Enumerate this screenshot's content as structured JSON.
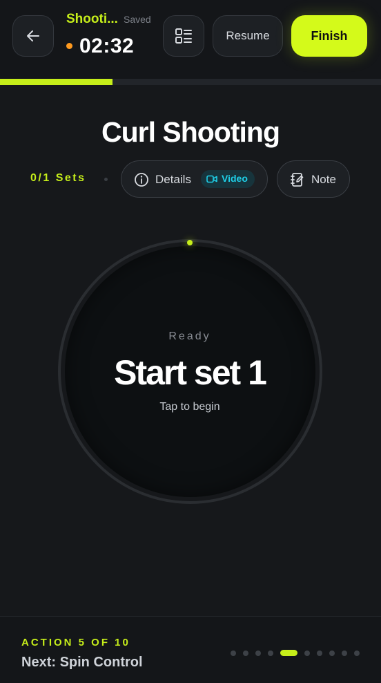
{
  "header": {
    "session_name": "Shooti...",
    "saved_label": "Saved",
    "timer": "02:32",
    "resume_label": "Resume",
    "finish_label": "Finish",
    "back_icon": "arrow-left-icon",
    "list_icon": "list-view-icon"
  },
  "progress": {
    "fraction": 0.295
  },
  "exercise": {
    "title": "Curl Shooting",
    "sets": "0/1 Sets",
    "details_label": "Details",
    "video_label": "Video",
    "note_label": "Note"
  },
  "dial": {
    "state": "Ready",
    "action": "Start set 1",
    "hint": "Tap to begin"
  },
  "footer": {
    "step": "ACTION 5 OF 10",
    "next": "Next: Spin Control",
    "total_steps": 10,
    "current_step": 5
  },
  "colors": {
    "accent": "#c6ee1a",
    "finish": "#d4fa1a",
    "recording": "#ff9a1f",
    "video": "#1fd0e8",
    "background": "#16181b"
  }
}
